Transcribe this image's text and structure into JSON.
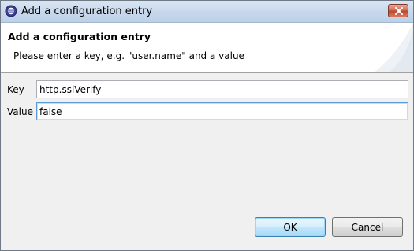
{
  "window": {
    "title": "Add a configuration entry",
    "icon": "eclipse-app-icon",
    "close_icon": "close-icon"
  },
  "header": {
    "title": "Add a configuration entry",
    "message": "Please enter a key, e.g. \"user.name\" and a value"
  },
  "form": {
    "key": {
      "label": "Key",
      "value": "http.sslVerify"
    },
    "value": {
      "label": "Value",
      "value": "false"
    }
  },
  "buttons": {
    "ok": "OK",
    "cancel": "Cancel"
  },
  "colors": {
    "title_bar": "#c9d9ec",
    "close_button": "#c0452d",
    "focus_border": "#5b9bd5",
    "default_button_border": "#3c7fb1"
  }
}
